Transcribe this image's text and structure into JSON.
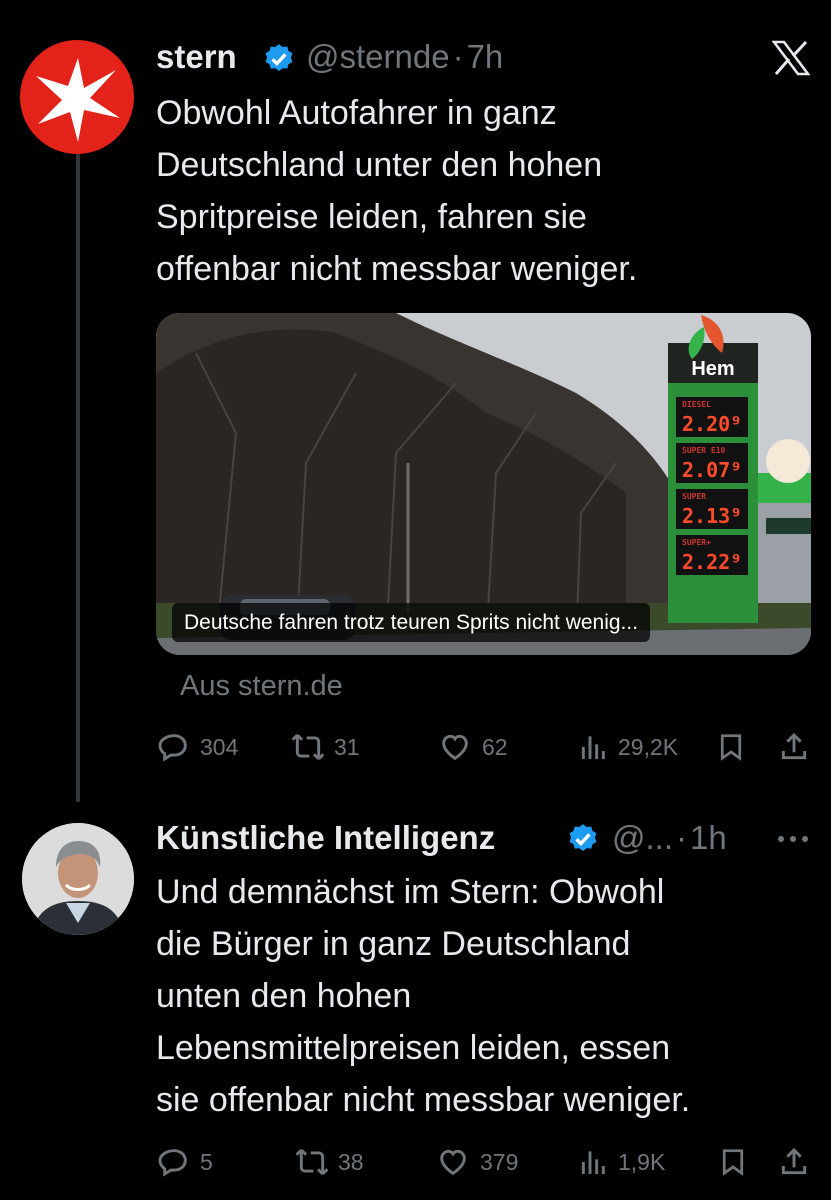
{
  "tweets": [
    {
      "display_name": "stern",
      "handle": "@sternde",
      "separator": "·",
      "time": "7h",
      "text_lines": [
        "Obwohl Autofahrer in ganz",
        "Deutschland unter den hohen",
        "Spritpreise leiden, fahren sie",
        "offenbar nicht messbar weniger."
      ],
      "card": {
        "caption": "Deutsche fahren trotz teuren Sprits nicht wenig...",
        "source": "Aus stern.de",
        "sign_brand": "Hem",
        "prices": [
          {
            "label": "DIESEL",
            "value": "2.20⁹"
          },
          {
            "label": "SUPER E10",
            "value": "2.07⁹"
          },
          {
            "label": "SUPER",
            "value": "2.13⁹"
          },
          {
            "label": "SUPER+",
            "value": "2.22⁹"
          }
        ]
      },
      "stats": {
        "replies": "304",
        "reposts": "31",
        "likes": "62",
        "views": "29,2K"
      },
      "top_icon": "x-logo-icon"
    },
    {
      "display_name": "Künstliche Intelligenz",
      "handle": "@...",
      "separator": "·",
      "time": "1h",
      "text_lines": [
        "Und demnächst im Stern: Obwohl",
        "die Bürger in ganz Deutschland",
        "unten den hohen",
        "Lebensmittelpreisen leiden, essen",
        "sie offenbar nicht messbar weniger."
      ],
      "stats": {
        "replies": "5",
        "reposts": "38",
        "likes": "379",
        "views": "1,9K"
      },
      "top_icon": "more-icon"
    }
  ],
  "colors": {
    "accent": "#1d9bf0",
    "muted": "#71767b",
    "text": "#e7e9ea",
    "stern_red": "#e32219"
  }
}
